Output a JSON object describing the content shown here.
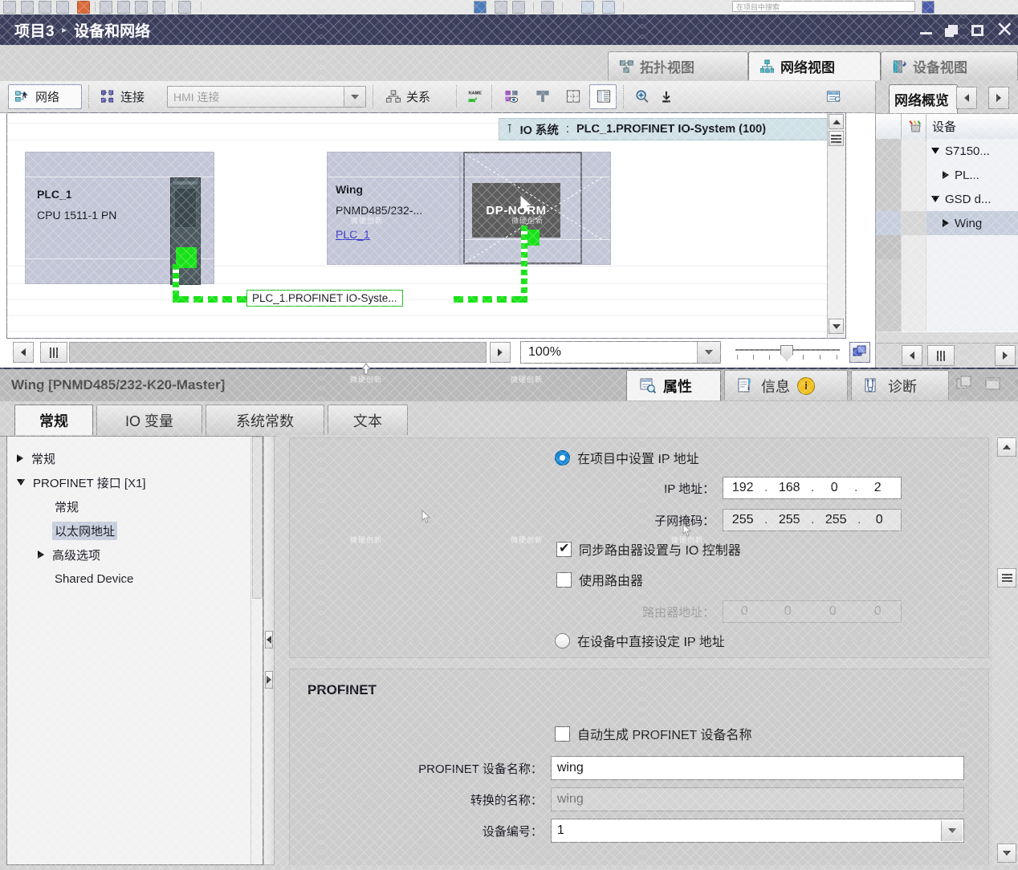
{
  "top_toolbar": {
    "search_placeholder": "在项目中搜索"
  },
  "titlebar": {
    "project": "项目3",
    "separator": "▸",
    "page": "设备和网络",
    "minimize": "最小化",
    "restore": "还原",
    "maximize": "最大化",
    "close": "关闭"
  },
  "view_tabs": [
    {
      "label": "拓扑视图",
      "icon": "topology-icon",
      "active": false
    },
    {
      "label": "网络视图",
      "icon": "network-icon",
      "active": true
    },
    {
      "label": "设备视图",
      "icon": "device-icon",
      "active": false
    }
  ],
  "toolbar": {
    "network_label": "网络",
    "connection_label": "连接",
    "hmi_value": "HMI 连接",
    "relation_label": "关系",
    "name_icon": "name-overlay-icon",
    "icons": [
      "highlight-icon",
      "page-break-icon",
      "grid-icon",
      "address-overview-icon",
      "zoom-in-icon",
      "zoom-fit-icon",
      "legend-icon"
    ]
  },
  "canvas": {
    "io_system_bar": {
      "pin": "⊺",
      "prefix": "IO 系统",
      "colon": ":",
      "value": "PLC_1.PROFINET IO-System (100)"
    },
    "plc": {
      "name": "PLC_1",
      "type": "CPU 1511-1 PN"
    },
    "slave": {
      "name": "Wing",
      "type": "PNMD485/232-...",
      "assigned": "PLC_1",
      "module_label": "DP-NORM"
    },
    "network_label": "PLC_1.PROFINET IO-Syste...",
    "zoom_value": "100%"
  },
  "network_overview": {
    "tab_label": "网络概览",
    "prev": "◀",
    "next": "▶",
    "col_wrench": "wrench-icon",
    "col_device": "设备",
    "rows": [
      {
        "label": "S7150...",
        "expanded": true,
        "indent": 0,
        "selected": false
      },
      {
        "label": "PL...",
        "expanded": false,
        "indent": 1,
        "selected": false
      },
      {
        "label": "GSD d...",
        "expanded": true,
        "indent": 0,
        "selected": false
      },
      {
        "label": "Wing",
        "expanded": false,
        "indent": 1,
        "selected": true
      }
    ]
  },
  "inspector": {
    "title": "Wing [PNMD485/232-K20-Master]",
    "tabs": [
      {
        "label": "常规",
        "active": true
      },
      {
        "label": "IO 变量",
        "active": false
      },
      {
        "label": "系统常数",
        "active": false
      },
      {
        "label": "文本",
        "active": false
      }
    ],
    "right_tabs": [
      {
        "label": "属性",
        "icon": "properties-icon",
        "active": true,
        "badge": ""
      },
      {
        "label": "信息",
        "icon": "info-icon",
        "active": false,
        "badge": "i"
      },
      {
        "label": "诊断",
        "icon": "diagnostics-icon",
        "active": false,
        "badge": ""
      }
    ],
    "window_actions": [
      "float-icon",
      "dock-icon",
      "chevron-down-icon"
    ],
    "tree": [
      {
        "label": "常规",
        "indent": 0,
        "marker": "collapsed",
        "selected": false
      },
      {
        "label": "PROFINET 接口 [X1]",
        "indent": 0,
        "marker": "expanded",
        "selected": false
      },
      {
        "label": "常规",
        "indent": 1,
        "marker": "none",
        "selected": false
      },
      {
        "label": "以太网地址",
        "indent": 1,
        "marker": "none",
        "selected": true
      },
      {
        "label": "高级选项",
        "indent": 1,
        "marker": "collapsed",
        "selected": false
      },
      {
        "label": "Shared Device",
        "indent": 1,
        "marker": "none",
        "selected": false
      }
    ],
    "ip_section": {
      "radio_project_label": "在项目中设置 IP 地址",
      "radio_project_selected": true,
      "ip_label": "IP 地址：",
      "ip_octets": [
        "192",
        "168",
        "0",
        "2"
      ],
      "mask_label": "子网掩码：",
      "mask_octets": [
        "255",
        "255",
        "255",
        "0"
      ],
      "sync_router_label": "同步路由器设置与 IO 控制器",
      "sync_router_checked": true,
      "use_router_label": "使用路由器",
      "use_router_checked": false,
      "router_label": "路由器地址：",
      "router_octets": [
        "0",
        "0",
        "0",
        "0"
      ],
      "router_disabled": true,
      "radio_device_label": "在设备中直接设定 IP 地址",
      "radio_device_selected": false
    },
    "profinet_section": {
      "title": "PROFINET",
      "auto_name_label": "自动生成 PROFINET 设备名称",
      "auto_name_checked": false,
      "device_name_label": "PROFINET 设备名称：",
      "device_name_value": "wing",
      "converted_name_label": "转换的名称：",
      "converted_name_value": "wing",
      "device_number_label": "设备编号：",
      "device_number_value": "1"
    }
  },
  "watermark": "微硬创新",
  "colors": {
    "title_bar": "#3b3f5c",
    "accent_green": "#18e118",
    "link_blue": "#3535c8",
    "radio_blue": "#1787d6",
    "io_bar": "#cfe0e6",
    "device_fill": "#c3c6d6",
    "selection": "#c6cedd"
  }
}
